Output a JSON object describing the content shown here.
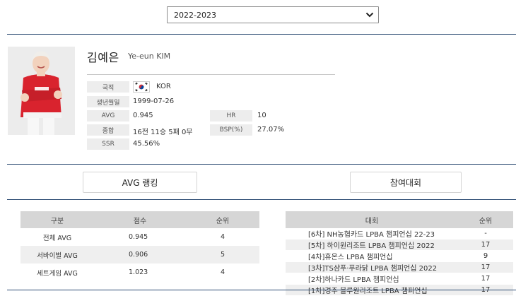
{
  "season": {
    "selected": "2022-2023"
  },
  "player": {
    "name_ko": "김예은",
    "name_en": "Ye-eun KIM",
    "photo_alt": "Player photo"
  },
  "profile": {
    "nationality_label": "국적",
    "nationality_value": "KOR",
    "birth_label": "생년월일",
    "birth_value": "1999-07-26",
    "avg_label": "AVG",
    "avg_value": "0.945",
    "hr_label": "HR",
    "hr_value": "10",
    "record_label": "종합",
    "record_value": "16전 11승 5패 0무",
    "bsp_label": "BSP(%)",
    "bsp_value": "27.07%",
    "ssr_label": "SSR",
    "ssr_value": "45.56%"
  },
  "buttons": {
    "avg_ranking": "AVG 랭킹",
    "participation": "참여대회"
  },
  "avg_table": {
    "headers": [
      "구분",
      "점수",
      "순위"
    ],
    "rows": [
      [
        "전체 AVG",
        "0.945",
        "4"
      ],
      [
        "서바이벌 AVG",
        "0.906",
        "5"
      ],
      [
        "세트게임 AVG",
        "1.023",
        "4"
      ]
    ]
  },
  "event_table": {
    "headers": [
      "대회",
      "순위"
    ],
    "rows": [
      [
        "[6차] NH농협카드 LPBA 챔피언십 22-23",
        "-"
      ],
      [
        "[5차] 하이원리조트 LPBA 챔피언십 2022",
        "17"
      ],
      [
        "[4차]휴온스 LPBA 챔피언십",
        "9"
      ],
      [
        "[3차]TS샴푸·푸라닭 LPBA 챔피언십 2022",
        "17"
      ],
      [
        "[2차]하나카드 LPBA 챔피언십",
        "17"
      ],
      [
        "[1차]경주 블루원리조트 LPBA 챔피언십",
        "17"
      ]
    ]
  },
  "colors": {
    "rule": "#2b4a72",
    "label_bg": "#ededed",
    "header_bg": "#d6d6d6",
    "jersey": "#d9232e"
  }
}
